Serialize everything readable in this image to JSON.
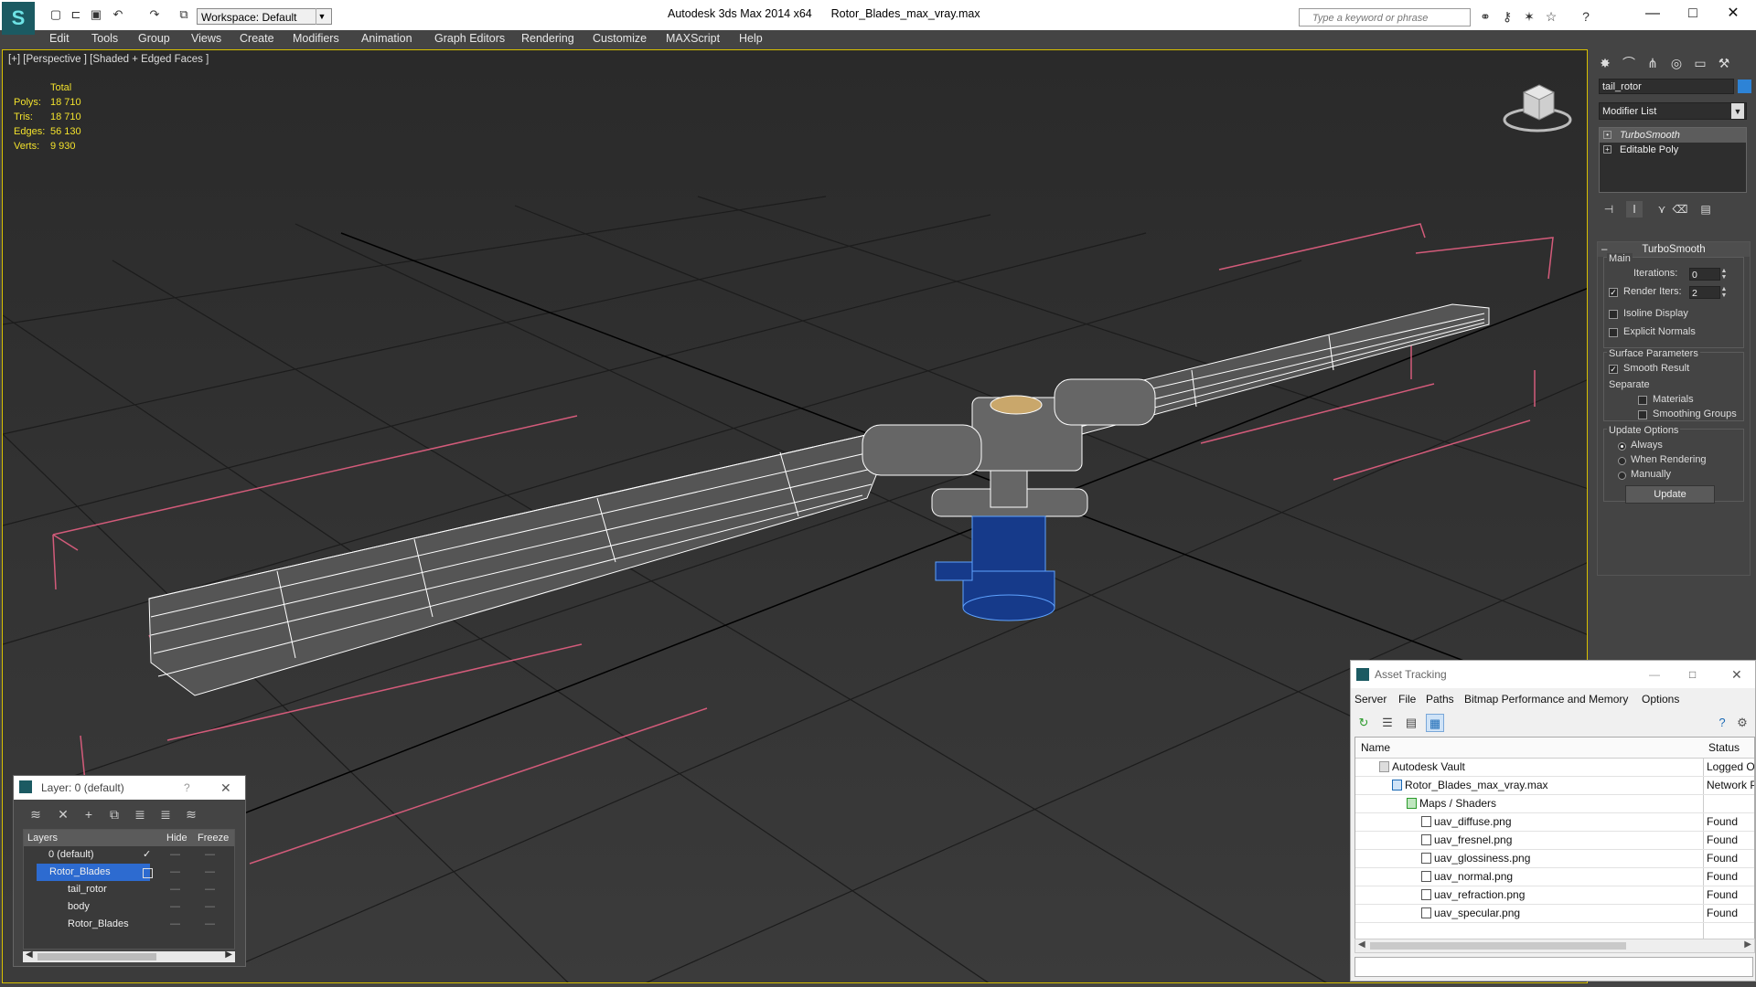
{
  "app": {
    "title": "Autodesk 3ds Max  2014 x64",
    "file": "Rotor_Blades_max_vray.max",
    "workspace": "Workspace: Default",
    "search_placeholder": "Type a keyword or phrase"
  },
  "menu": [
    "Edit",
    "Tools",
    "Group",
    "Views",
    "Create",
    "Modifiers",
    "Animation",
    "Graph Editors",
    "Rendering",
    "Customize",
    "MAXScript",
    "Help"
  ],
  "viewport": {
    "label": "[+] [Perspective ] [Shaded + Edged Faces ]",
    "stats_header": "Total",
    "stats": [
      {
        "k": "Polys:",
        "v": "18 710"
      },
      {
        "k": "Tris:",
        "v": "18 710"
      },
      {
        "k": "Edges:",
        "v": "56 130"
      },
      {
        "k": "Verts:",
        "v": "9 930"
      }
    ]
  },
  "command_panel": {
    "object_name": "tail_rotor",
    "object_color": "#2d83d6",
    "modifier_list": "Modifier List",
    "stack": [
      "TurboSmooth",
      "Editable Poly"
    ],
    "rollout_title": "TurboSmooth",
    "main_group": "Main",
    "iterations_label": "Iterations:",
    "iterations_value": "0",
    "render_iters_label": "Render Iters:",
    "render_iters_value": "2",
    "render_iters_checked": true,
    "isoline_label": "Isoline Display",
    "explicit_normals_label": "Explicit Normals",
    "surface_group": "Surface Parameters",
    "smooth_result_label": "Smooth Result",
    "separate_label": "Separate",
    "materials_label": "Materials",
    "smoothing_groups_label": "Smoothing Groups",
    "update_group": "Update Options",
    "radio_always": "Always",
    "radio_when_rendering": "When Rendering",
    "radio_manually": "Manually",
    "update_button": "Update"
  },
  "layer_window": {
    "title": "Layer: 0 (default)",
    "help": "?",
    "col_layers": "Layers",
    "col_hide": "Hide",
    "col_freeze": "Freeze",
    "rows": [
      {
        "name": "0 (default)",
        "indent": 1
      },
      {
        "name": "Rotor_Blades",
        "indent": 1
      },
      {
        "name": "tail_rotor",
        "indent": 2
      },
      {
        "name": "body",
        "indent": 2
      },
      {
        "name": "Rotor_Blades",
        "indent": 2
      }
    ]
  },
  "asset_tracking": {
    "title": "Asset Tracking",
    "menu": [
      "Server",
      "File",
      "Paths",
      "Bitmap Performance and Memory",
      "Options"
    ],
    "col_name": "Name",
    "col_status": "Status",
    "rows": [
      {
        "name": "Autodesk Vault",
        "status": "Logged Ou",
        "indent": 1
      },
      {
        "name": "Rotor_Blades_max_vray.max",
        "status": "Network P",
        "indent": 2
      },
      {
        "name": "Maps / Shaders",
        "status": "",
        "indent": 3
      },
      {
        "name": "uav_diffuse.png",
        "status": "Found",
        "indent": 4
      },
      {
        "name": "uav_fresnel.png",
        "status": "Found",
        "indent": 4
      },
      {
        "name": "uav_glossiness.png",
        "status": "Found",
        "indent": 4
      },
      {
        "name": "uav_normal.png",
        "status": "Found",
        "indent": 4
      },
      {
        "name": "uav_refraction.png",
        "status": "Found",
        "indent": 4
      },
      {
        "name": "uav_specular.png",
        "status": "Found",
        "indent": 4
      }
    ]
  }
}
